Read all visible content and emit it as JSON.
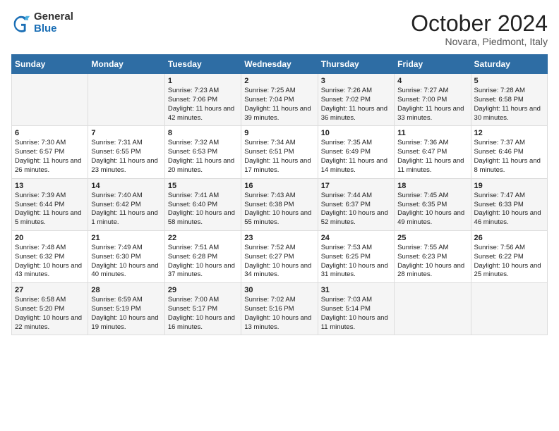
{
  "header": {
    "logo_general": "General",
    "logo_blue": "Blue",
    "month": "October 2024",
    "location": "Novara, Piedmont, Italy"
  },
  "days_of_week": [
    "Sunday",
    "Monday",
    "Tuesday",
    "Wednesday",
    "Thursday",
    "Friday",
    "Saturday"
  ],
  "weeks": [
    [
      {
        "day": "",
        "info": ""
      },
      {
        "day": "",
        "info": ""
      },
      {
        "day": "1",
        "info": "Sunrise: 7:23 AM\nSunset: 7:06 PM\nDaylight: 11 hours and 42 minutes."
      },
      {
        "day": "2",
        "info": "Sunrise: 7:25 AM\nSunset: 7:04 PM\nDaylight: 11 hours and 39 minutes."
      },
      {
        "day": "3",
        "info": "Sunrise: 7:26 AM\nSunset: 7:02 PM\nDaylight: 11 hours and 36 minutes."
      },
      {
        "day": "4",
        "info": "Sunrise: 7:27 AM\nSunset: 7:00 PM\nDaylight: 11 hours and 33 minutes."
      },
      {
        "day": "5",
        "info": "Sunrise: 7:28 AM\nSunset: 6:58 PM\nDaylight: 11 hours and 30 minutes."
      }
    ],
    [
      {
        "day": "6",
        "info": "Sunrise: 7:30 AM\nSunset: 6:57 PM\nDaylight: 11 hours and 26 minutes."
      },
      {
        "day": "7",
        "info": "Sunrise: 7:31 AM\nSunset: 6:55 PM\nDaylight: 11 hours and 23 minutes."
      },
      {
        "day": "8",
        "info": "Sunrise: 7:32 AM\nSunset: 6:53 PM\nDaylight: 11 hours and 20 minutes."
      },
      {
        "day": "9",
        "info": "Sunrise: 7:34 AM\nSunset: 6:51 PM\nDaylight: 11 hours and 17 minutes."
      },
      {
        "day": "10",
        "info": "Sunrise: 7:35 AM\nSunset: 6:49 PM\nDaylight: 11 hours and 14 minutes."
      },
      {
        "day": "11",
        "info": "Sunrise: 7:36 AM\nSunset: 6:47 PM\nDaylight: 11 hours and 11 minutes."
      },
      {
        "day": "12",
        "info": "Sunrise: 7:37 AM\nSunset: 6:46 PM\nDaylight: 11 hours and 8 minutes."
      }
    ],
    [
      {
        "day": "13",
        "info": "Sunrise: 7:39 AM\nSunset: 6:44 PM\nDaylight: 11 hours and 5 minutes."
      },
      {
        "day": "14",
        "info": "Sunrise: 7:40 AM\nSunset: 6:42 PM\nDaylight: 11 hours and 1 minute."
      },
      {
        "day": "15",
        "info": "Sunrise: 7:41 AM\nSunset: 6:40 PM\nDaylight: 10 hours and 58 minutes."
      },
      {
        "day": "16",
        "info": "Sunrise: 7:43 AM\nSunset: 6:38 PM\nDaylight: 10 hours and 55 minutes."
      },
      {
        "day": "17",
        "info": "Sunrise: 7:44 AM\nSunset: 6:37 PM\nDaylight: 10 hours and 52 minutes."
      },
      {
        "day": "18",
        "info": "Sunrise: 7:45 AM\nSunset: 6:35 PM\nDaylight: 10 hours and 49 minutes."
      },
      {
        "day": "19",
        "info": "Sunrise: 7:47 AM\nSunset: 6:33 PM\nDaylight: 10 hours and 46 minutes."
      }
    ],
    [
      {
        "day": "20",
        "info": "Sunrise: 7:48 AM\nSunset: 6:32 PM\nDaylight: 10 hours and 43 minutes."
      },
      {
        "day": "21",
        "info": "Sunrise: 7:49 AM\nSunset: 6:30 PM\nDaylight: 10 hours and 40 minutes."
      },
      {
        "day": "22",
        "info": "Sunrise: 7:51 AM\nSunset: 6:28 PM\nDaylight: 10 hours and 37 minutes."
      },
      {
        "day": "23",
        "info": "Sunrise: 7:52 AM\nSunset: 6:27 PM\nDaylight: 10 hours and 34 minutes."
      },
      {
        "day": "24",
        "info": "Sunrise: 7:53 AM\nSunset: 6:25 PM\nDaylight: 10 hours and 31 minutes."
      },
      {
        "day": "25",
        "info": "Sunrise: 7:55 AM\nSunset: 6:23 PM\nDaylight: 10 hours and 28 minutes."
      },
      {
        "day": "26",
        "info": "Sunrise: 7:56 AM\nSunset: 6:22 PM\nDaylight: 10 hours and 25 minutes."
      }
    ],
    [
      {
        "day": "27",
        "info": "Sunrise: 6:58 AM\nSunset: 5:20 PM\nDaylight: 10 hours and 22 minutes."
      },
      {
        "day": "28",
        "info": "Sunrise: 6:59 AM\nSunset: 5:19 PM\nDaylight: 10 hours and 19 minutes."
      },
      {
        "day": "29",
        "info": "Sunrise: 7:00 AM\nSunset: 5:17 PM\nDaylight: 10 hours and 16 minutes."
      },
      {
        "day": "30",
        "info": "Sunrise: 7:02 AM\nSunset: 5:16 PM\nDaylight: 10 hours and 13 minutes."
      },
      {
        "day": "31",
        "info": "Sunrise: 7:03 AM\nSunset: 5:14 PM\nDaylight: 10 hours and 11 minutes."
      },
      {
        "day": "",
        "info": ""
      },
      {
        "day": "",
        "info": ""
      }
    ]
  ]
}
